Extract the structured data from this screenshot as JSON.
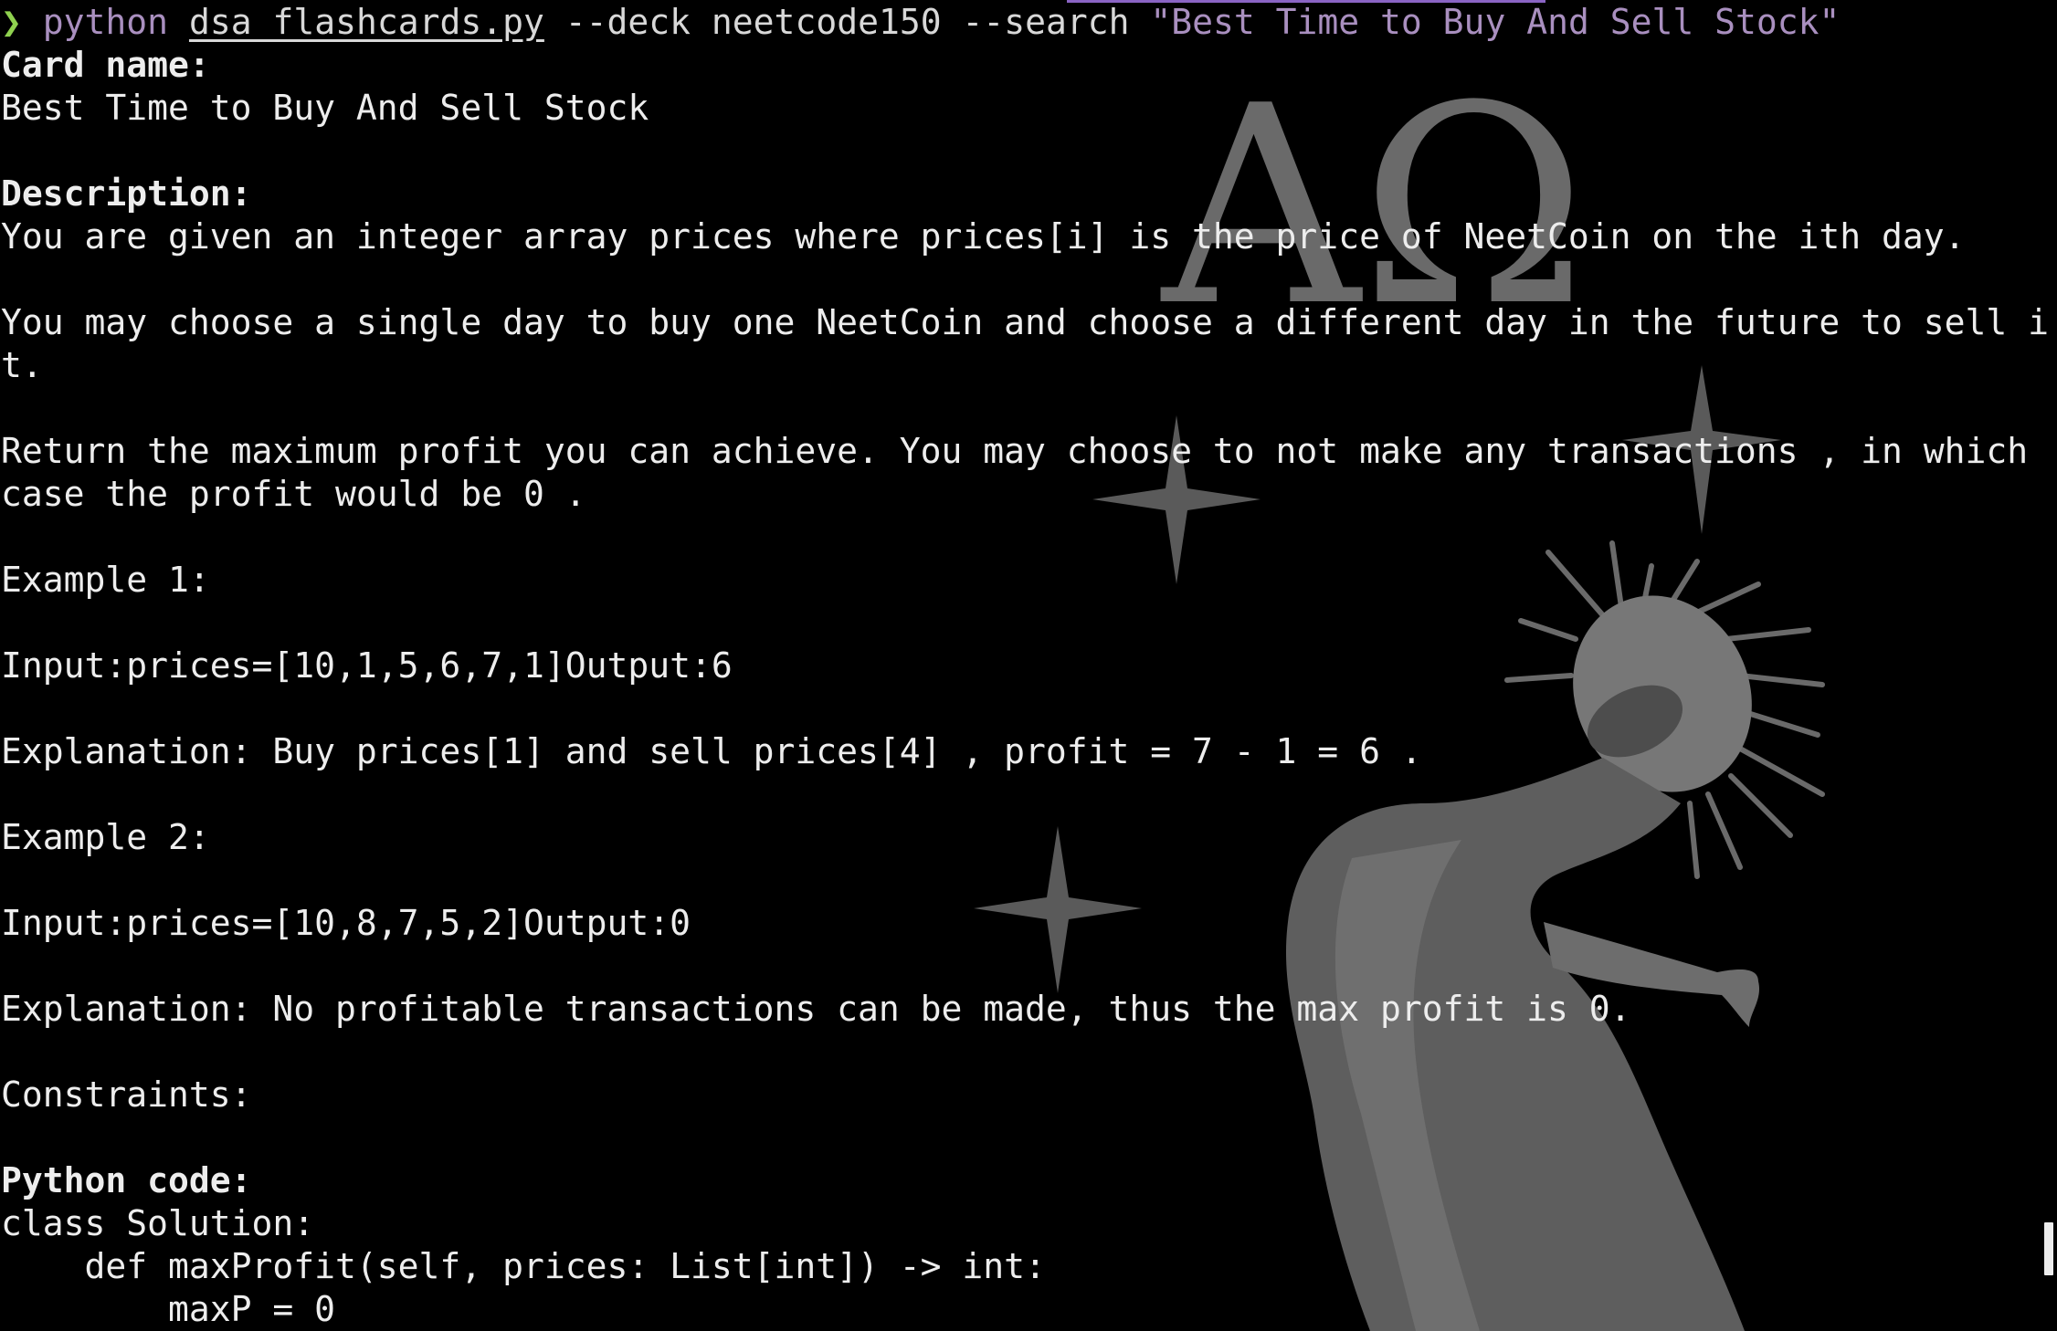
{
  "colors": {
    "background": "#000000",
    "text": "#ededed",
    "prompt_arrow": "#8fd14f",
    "command_string": "#a98fbf",
    "wallpaper_art": "#6a6a6a",
    "progress_accent": "#8a64c4"
  },
  "command": {
    "prompt_symbol": "❯",
    "program": "python",
    "script": "dsa_flashcards.py",
    "args": "--deck neetcode150 --search",
    "query": "\"Best Time to Buy And Sell Stock\""
  },
  "wallpaper": {
    "greek_letters": "AΩ",
    "icons": [
      "sparkle-star-icon",
      "sparkle-star-icon",
      "sparkle-star-icon",
      "crowned-figure-sculpture"
    ]
  },
  "card": {
    "name_label": "Card name:",
    "name": "Best Time to Buy And Sell Stock",
    "description_label": "Description:",
    "description_lines": [
      "You are given an integer array prices where prices[i] is the price of NeetCoin on the ith day.",
      "",
      "You may choose a single day to buy one NeetCoin and choose a different day in the future to sell i",
      "t.",
      "",
      "Return the maximum profit you can achieve. You may choose to not make any transactions , in which",
      "case the profit would be 0 ."
    ],
    "example1_label": "Example 1:",
    "example1_io": "Input:prices=[10,1,5,6,7,1]Output:6",
    "example1_explanation": "Explanation: Buy prices[1] and sell prices[4] , profit = 7 - 1 = 6 .",
    "example2_label": "Example 2:",
    "example2_io": "Input:prices=[10,8,7,5,2]Output:0",
    "example2_explanation": "Explanation: No profitable transactions can be made, thus the max profit is 0.",
    "constraints_label": "Constraints:",
    "code_label": "Python code:",
    "code_lines": [
      "class Solution:",
      "    def maxProfit(self, prices: List[int]) -> int:",
      "        maxP = 0"
    ]
  }
}
